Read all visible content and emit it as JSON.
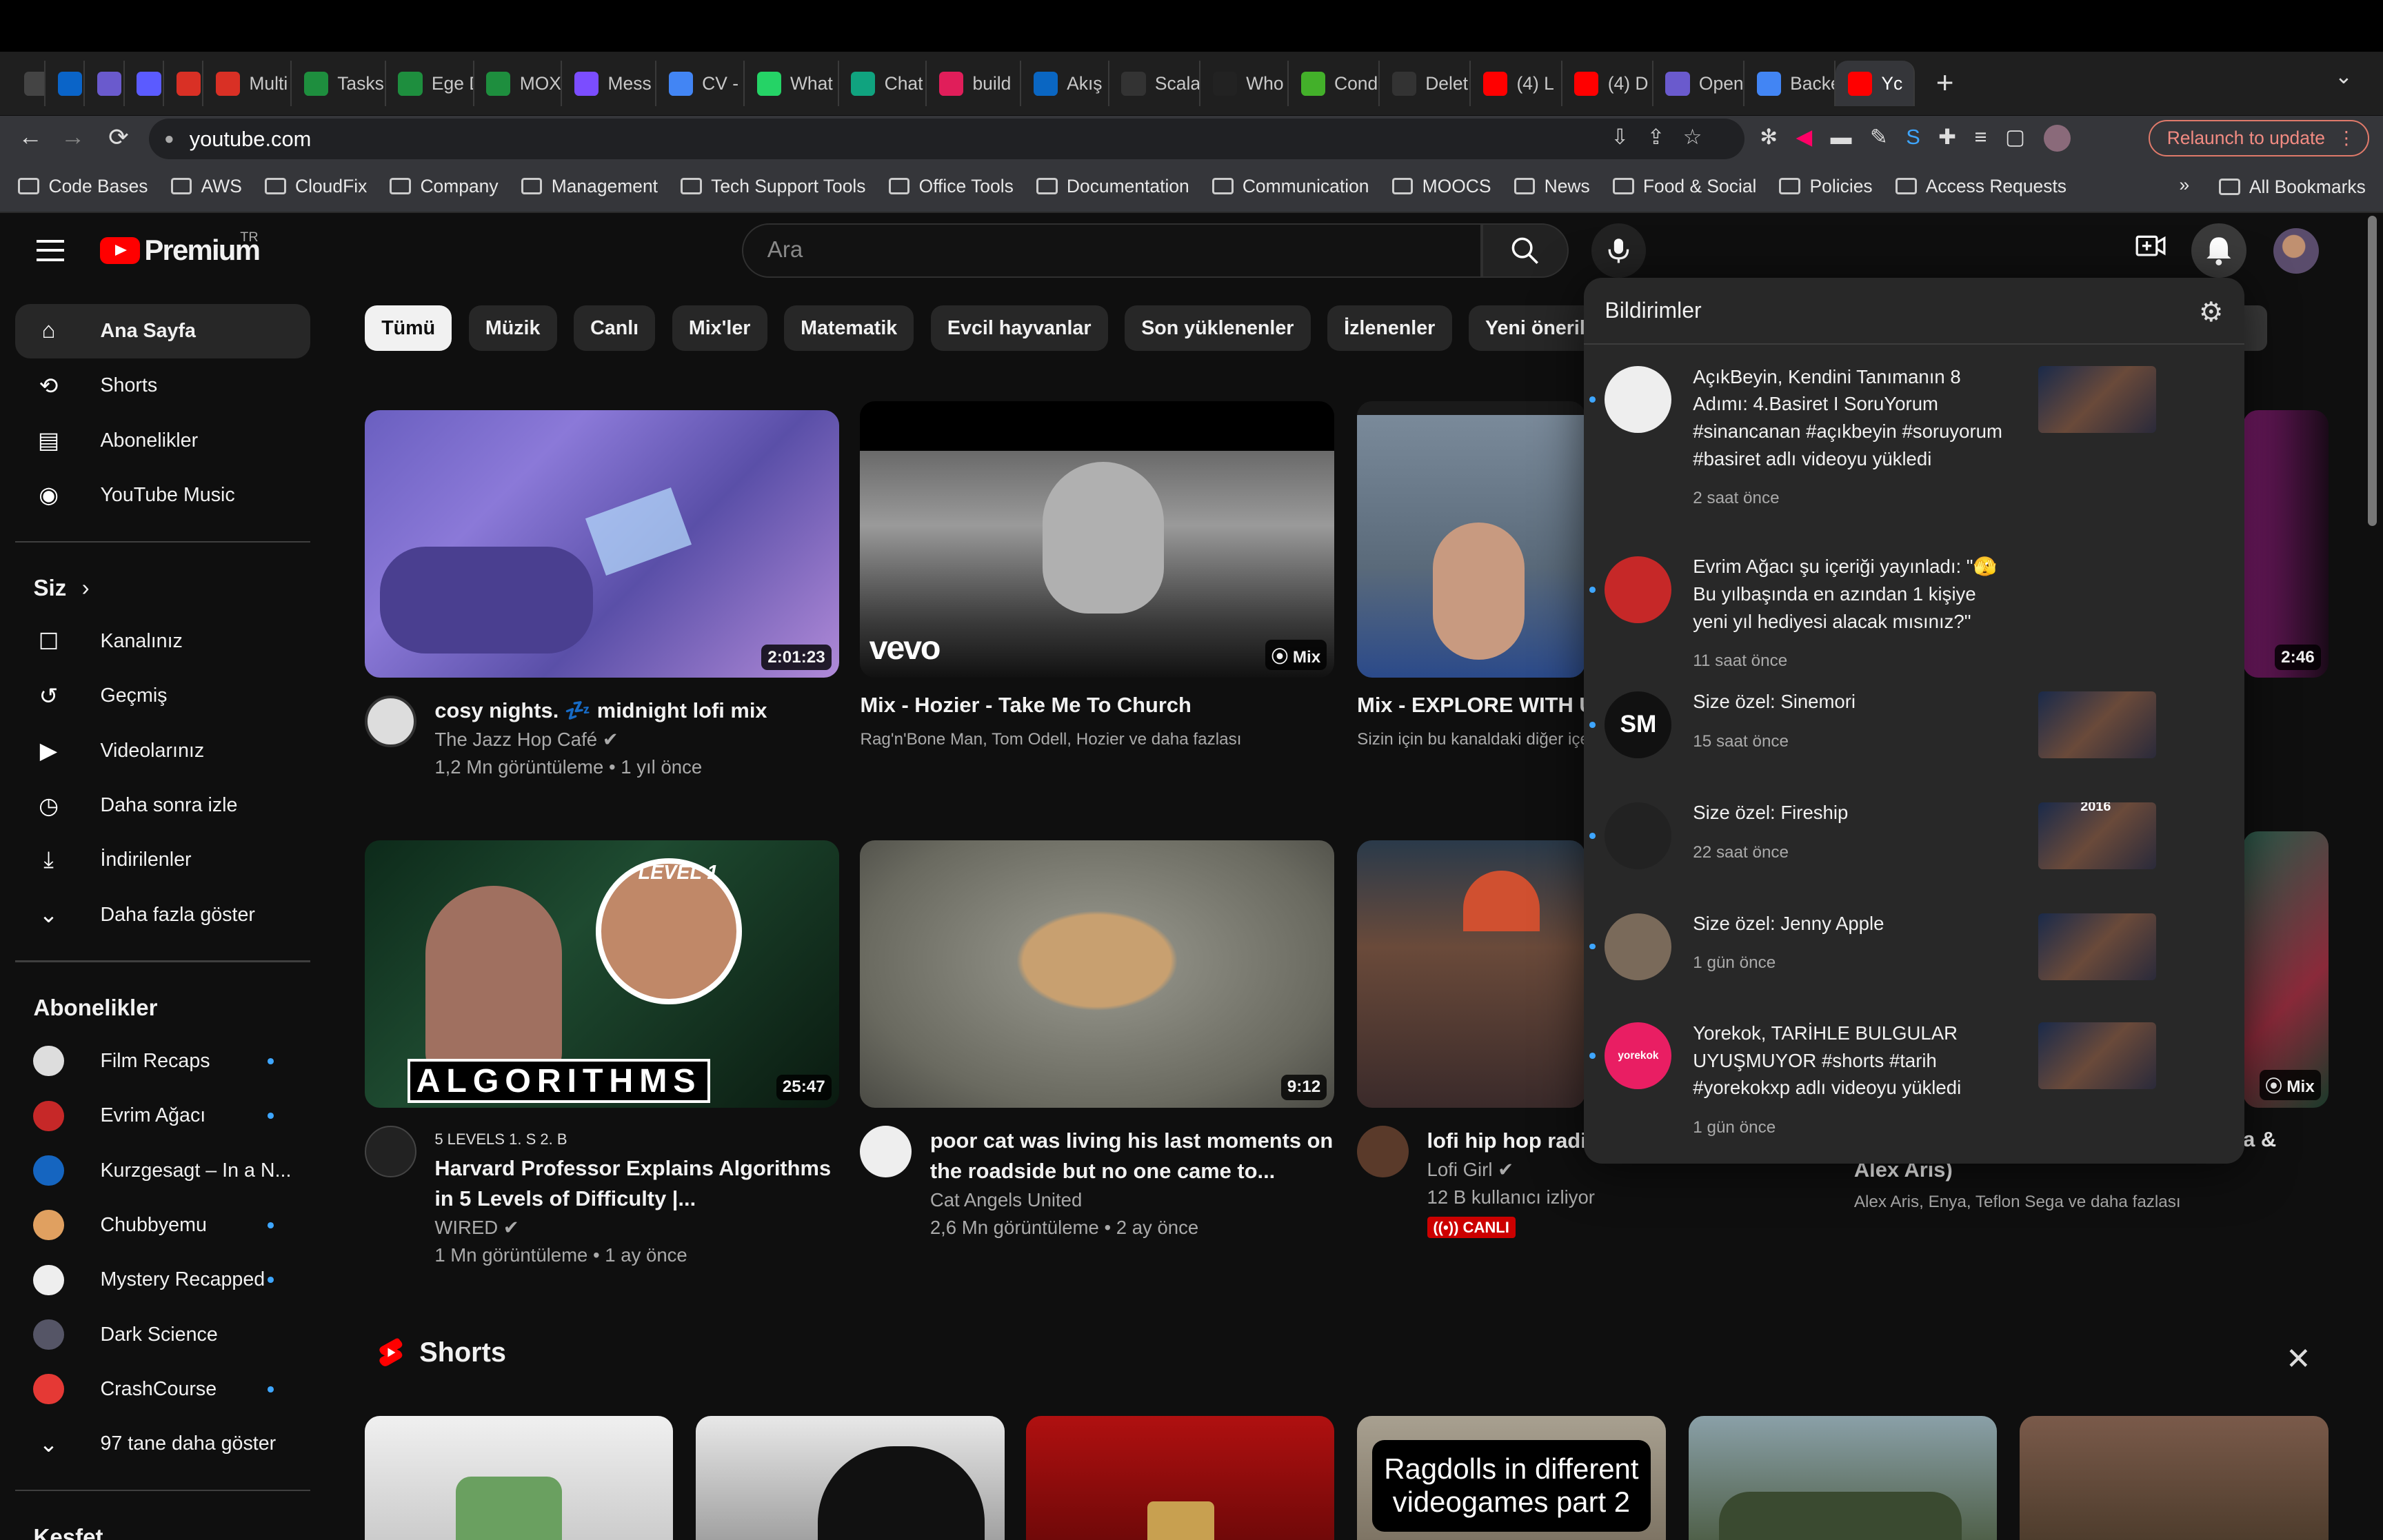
{
  "browser": {
    "tabs": [
      {
        "label": "",
        "icon": "grid-icon",
        "color": "#444"
      },
      {
        "label": "",
        "icon": "outlook-icon",
        "color": "#0a64c8"
      },
      {
        "label": "",
        "icon": "swirl-icon",
        "color": "#6a5acd"
      },
      {
        "label": "",
        "icon": "clock-icon",
        "color": "#5b5bff"
      },
      {
        "label": "",
        "icon": "gmail-icon",
        "color": "#d93025"
      },
      {
        "label": "Multi",
        "icon": "gmail-icon",
        "color": "#d93025"
      },
      {
        "label": "Tasks",
        "icon": "tasks-icon",
        "color": "#1e8e3e"
      },
      {
        "label": "Ege D",
        "icon": "sheets-icon",
        "color": "#1e8e3e"
      },
      {
        "label": "MOX-",
        "icon": "sheets-icon",
        "color": "#1e8e3e"
      },
      {
        "label": "Mess",
        "icon": "messenger-icon",
        "color": "#7b4dff"
      },
      {
        "label": "CV - ",
        "icon": "docs-icon",
        "color": "#4285f4"
      },
      {
        "label": "What",
        "icon": "whatsapp-icon",
        "color": "#25d366"
      },
      {
        "label": "Chat",
        "icon": "chatgpt-icon",
        "color": "#10a37f"
      },
      {
        "label": "build",
        "icon": "slack-icon",
        "color": "#e01e5a"
      },
      {
        "label": "Akış",
        "icon": "linkedin-icon",
        "color": "#0a66c2"
      },
      {
        "label": "Scala",
        "icon": "scala-icon",
        "color": "#333"
      },
      {
        "label": "Who",
        "icon": "terminal-icon",
        "color": "#222"
      },
      {
        "label": "Cond",
        "icon": "conda-icon",
        "color": "#43b02a"
      },
      {
        "label": "Delet",
        "icon": "github-icon",
        "color": "#333"
      },
      {
        "label": "(4) L",
        "icon": "youtube-icon",
        "color": "#f00"
      },
      {
        "label": "(4) D",
        "icon": "youtube-icon",
        "color": "#f00"
      },
      {
        "label": "Open",
        "icon": "openai-icon",
        "color": "#6a5acd"
      },
      {
        "label": "Backe",
        "icon": "docs-icon",
        "color": "#4285f4"
      },
      {
        "label": "Yc",
        "icon": "youtube-icon",
        "color": "#f00",
        "active": true
      }
    ],
    "new_tab": "+",
    "url": "youtube.com",
    "relaunch": "Relaunch to update",
    "bookmarks": [
      "Code Bases",
      "AWS",
      "CloudFix",
      "Company",
      "Management",
      "Tech Support Tools",
      "Office Tools",
      "Documentation",
      "Communication",
      "MOOCS",
      "News",
      "Food & Social",
      "Policies",
      "Access Requests"
    ],
    "bookmarks_more": "»",
    "all_bookmarks": "All Bookmarks"
  },
  "header": {
    "logo": "Premium",
    "country": "TR",
    "search_placeholder": "Ara"
  },
  "sidebar": {
    "main": [
      {
        "label": "Ana Sayfa",
        "icon": "home-icon",
        "active": true
      },
      {
        "label": "Shorts",
        "icon": "shorts-icon"
      },
      {
        "label": "Abonelikler",
        "icon": "subscriptions-icon"
      },
      {
        "label": "YouTube Music",
        "icon": "music-icon"
      }
    ],
    "you_heading": "Siz",
    "you": [
      {
        "label": "Kanalınız",
        "icon": "channel-icon"
      },
      {
        "label": "Geçmiş",
        "icon": "history-icon"
      },
      {
        "label": "Videolarınız",
        "icon": "your-videos-icon"
      },
      {
        "label": "Daha sonra izle",
        "icon": "watch-later-icon"
      },
      {
        "label": "İndirilenler",
        "icon": "download-icon"
      },
      {
        "label": "Daha fazla göster",
        "icon": "chevron-down-icon"
      }
    ],
    "subs_heading": "Abonelikler",
    "subs": [
      {
        "label": "Film Recaps",
        "color": "#ddd",
        "dot": true
      },
      {
        "label": "Evrim Ağacı",
        "color": "#c62828",
        "dot": true
      },
      {
        "label": "Kurzgesagt – In a N...",
        "color": "#1565c0",
        "dot": false
      },
      {
        "label": "Chubbyemu",
        "color": "#e0a060",
        "dot": true
      },
      {
        "label": "Mystery Recapped",
        "color": "#eee",
        "dot": true
      },
      {
        "label": "Dark Science",
        "color": "#556",
        "dot": false
      },
      {
        "label": "CrashCourse",
        "color": "#e53935",
        "dot": true
      },
      {
        "label": "97 tane daha göster",
        "icon": "chevron-down-icon"
      }
    ],
    "explore_heading": "Keşfet"
  },
  "chips": [
    "Tümü",
    "Müzik",
    "Canlı",
    "Mix'ler",
    "Matematik",
    "Evcil hayvanlar",
    "Son yüklenenler",
    "İzlenenler",
    "Yeni öneriler"
  ],
  "videos": [
    {
      "title": "cosy nights. 💤 midnight lofi mix",
      "channel": "The Jazz Hop Café",
      "verified": true,
      "stats": "1,2 Mn görüntüleme • 1 yıl önce",
      "duration": "2:01:23"
    },
    {
      "title": "Mix - Hozier - Take Me To Church",
      "channel": "Rag'n'Bone Man, Tom Odell, Hozier ve daha fazlası",
      "badge": "Mix",
      "overlay": "vevo"
    },
    {
      "title": "Mix - EXPLORE WITH U",
      "channel": "Sizin için bu kanaldaki diğer içe"
    },
    {
      "duration": "2:46"
    },
    {
      "title": "Harvard Professor Explains Algorithms in 5 Levels of Difficulty |...",
      "channel": "WIRED",
      "verified": true,
      "stats": "1 Mn görüntüleme • 1 ay önce",
      "duration": "25:47",
      "tag": "5 LEVELS  1. S 2. B",
      "overlay": "ALGORITHMS",
      "level": "LEVEL 1"
    },
    {
      "title": "poor cat was living his last moments on the roadside but no one came to...",
      "channel": "Cat Angels United",
      "stats": "2,6 Mn görüntüleme • 2 ay önce",
      "duration": "9:12"
    },
    {
      "title": "lofi hip hop radic relax/study to",
      "channel": "Lofi Girl",
      "verified": true,
      "stats": "12 B kullanıcı izliyor",
      "live": "CANLI"
    },
    {
      "title": "Alex Aris)",
      "title_tail": "a &",
      "channel": "Alex Aris, Enya, Teflon Sega ve daha fazlası",
      "badge": "Mix"
    }
  ],
  "shorts": {
    "title": "Shorts",
    "cards": [
      "",
      "",
      "",
      "Ragdolls in different videogames part 2",
      "",
      ""
    ]
  },
  "notifications": {
    "title": "Bildirimler",
    "items": [
      {
        "text": "AçıkBeyin, Kendini Tanımanın 8 Adımı: 4.Basiret I SoruYorum #sinancanan #açıkbeyin #soruyorum #basiret adlı videoyu yükledi",
        "time": "2 saat önce",
        "avatar": "#eee",
        "thumb": true
      },
      {
        "text": "Evrim Ağacı şu içeriği yayınladı: \"🫣 Bu yılbaşında en azından 1 kişiye yeni yıl hediyesi alacak mısınız?\"",
        "time": "11 saat önce",
        "avatar": "#c62828",
        "thumb": false
      },
      {
        "text": "Size özel: Sinemori",
        "time": "15 saat önce",
        "avatar": "#111",
        "avatar_text": "SM",
        "thumb": true
      },
      {
        "text": "Size özel: Fireship",
        "time": "22 saat önce",
        "avatar": "#222",
        "thumb": true,
        "thumb_text": "2016"
      },
      {
        "text": "Size özel: Jenny Apple",
        "time": "1 gün önce",
        "avatar": "#7a6a5a",
        "thumb": true
      },
      {
        "text": "Yorekok, TARİHLE BULGULAR UYUŞMUYOR #shorts #tarih #yorekokxp adlı videoyu yükledi",
        "time": "1 gün önce",
        "avatar": "#e91e63",
        "avatar_text": "yorekok",
        "thumb": true
      }
    ]
  }
}
